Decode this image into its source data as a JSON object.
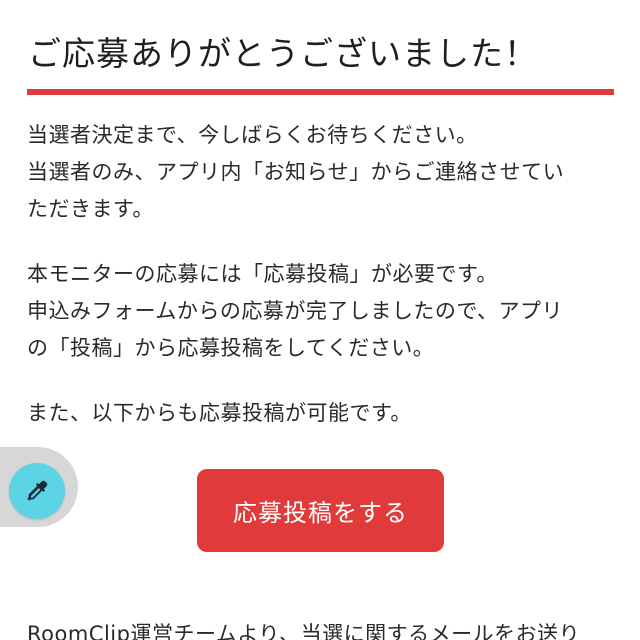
{
  "title": "ご応募ありがとうございました！",
  "paragraphs": {
    "p1": {
      "line1": "当選者決定まで、今しばらくお待ちください。",
      "line2": "当選者のみ、アプリ内「お知らせ」からご連絡させてい",
      "line3": "ただきます。"
    },
    "p2": {
      "line1": "本モニターの応募には「応募投稿」が必要です。",
      "line2": "申込みフォームからの応募が完了しましたので、アプリ",
      "line3": "の「投稿」から応募投稿をしてください。"
    },
    "p3": {
      "line1": "また、以下からも応募投稿が可能です。"
    }
  },
  "post_button_label": "応募投稿をする",
  "bottom_text": "RoomClip運営チームより、当選に関するメールをお送り",
  "floating_tool": {
    "icon": "eyedropper-icon"
  },
  "colors": {
    "accent": "#e03a3a",
    "tool": "#5dd3e6",
    "text": "#2a2a2a"
  }
}
